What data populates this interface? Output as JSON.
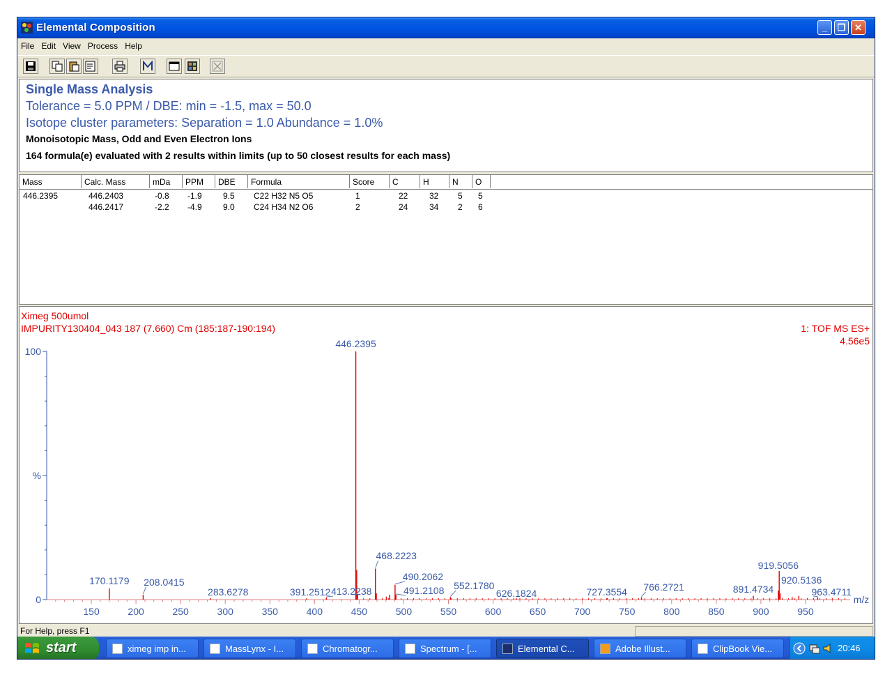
{
  "window": {
    "title": "Elemental Composition"
  },
  "menu": [
    "File",
    "Edit",
    "View",
    "Process",
    "Help"
  ],
  "header": {
    "title": "Single Mass Analysis",
    "tolerance": "Tolerance = 5.0 PPM   /   DBE: min = -1.5, max = 50.0",
    "isotope": "Isotope cluster parameters: Separation = 1.0   Abundance = 1.0%",
    "ion_type": "Monoisotopic Mass, Odd and Even Electron Ions",
    "summary": "164 formula(e) evaluated with 2 results within limits (up to 50 closest results for each mass)"
  },
  "table": {
    "columns": [
      "Mass",
      "Calc. Mass",
      "mDa",
      "PPM",
      "DBE",
      "Formula",
      "Score",
      "C",
      "H",
      "N",
      "O"
    ],
    "rows": [
      {
        "mass": "446.2395",
        "calc": "446.2403",
        "mda": "-0.8",
        "ppm": "-1.9",
        "dbe": "9.5",
        "formula": "C22 H32 N5 O5",
        "score": "1",
        "c": "22",
        "h": "32",
        "n": "5",
        "o": "5"
      },
      {
        "mass": "",
        "calc": "446.2417",
        "mda": "-2.2",
        "ppm": "-4.9",
        "dbe": "9.0",
        "formula": "C24 H34 N2 O6",
        "score": "2",
        "c": "24",
        "h": "34",
        "n": "2",
        "o": "6"
      }
    ]
  },
  "spectrum": {
    "sample": "Ximeg 500umol",
    "scan": "IMPURITY130404_043 187 (7.660) Cm (185:187-190:194)",
    "mode": "1: TOF MS ES+",
    "intensity": "4.56e5"
  },
  "chart_data": {
    "type": "bar",
    "xlabel": "m/z",
    "ylabel": "%",
    "xlim": [
      100,
      1000
    ],
    "ylim": [
      0,
      100
    ],
    "xticks": [
      150,
      200,
      250,
      300,
      350,
      400,
      450,
      500,
      550,
      600,
      650,
      700,
      750,
      800,
      850,
      900,
      950
    ],
    "yticks": [
      {
        "value": 100,
        "label": "100"
      },
      {
        "value": 50,
        "label": "%"
      },
      {
        "value": 0,
        "label": "0"
      }
    ],
    "peaks": [
      {
        "mz": 170.1179,
        "intensity": 4.5,
        "label": "170.1179"
      },
      {
        "mz": 208.0415,
        "intensity": 2.0,
        "label": "208.0415"
      },
      {
        "mz": 283.6278,
        "intensity": 0.5,
        "label": "283.6278"
      },
      {
        "mz": 391.2512,
        "intensity": 0.5,
        "label": "391.2512"
      },
      {
        "mz": 413.2238,
        "intensity": 0.8,
        "label": "413.2238"
      },
      {
        "mz": 446.2395,
        "intensity": 100,
        "label": "446.2395"
      },
      {
        "mz": 447.24,
        "intensity": 12,
        "label": ""
      },
      {
        "mz": 448.24,
        "intensity": 2.2,
        "label": ""
      },
      {
        "mz": 468.2223,
        "intensity": 12.5,
        "label": "468.2223"
      },
      {
        "mz": 469.23,
        "intensity": 2.5,
        "label": ""
      },
      {
        "mz": 480.5,
        "intensity": 1.2,
        "label": ""
      },
      {
        "mz": 484.2,
        "intensity": 2.0,
        "label": ""
      },
      {
        "mz": 490.2062,
        "intensity": 6.0,
        "label": "490.2062"
      },
      {
        "mz": 491.2108,
        "intensity": 2.0,
        "label": "491.2108"
      },
      {
        "mz": 552.178,
        "intensity": 1.0,
        "label": "552.1780"
      },
      {
        "mz": 626.1824,
        "intensity": 0.5,
        "label": "626.1824"
      },
      {
        "mz": 727.3554,
        "intensity": 0.5,
        "label": "727.3554"
      },
      {
        "mz": 766.2721,
        "intensity": 1.0,
        "label": "766.2721"
      },
      {
        "mz": 891.4734,
        "intensity": 1.5,
        "label": "891.4734"
      },
      {
        "mz": 919.5056,
        "intensity": 3.6,
        "label": "919.5056"
      },
      {
        "mz": 920.5136,
        "intensity": 11.5,
        "label": "920.5136"
      },
      {
        "mz": 921.52,
        "intensity": 2.5,
        "label": ""
      },
      {
        "mz": 935.0,
        "intensity": 1.0,
        "label": ""
      },
      {
        "mz": 942.5,
        "intensity": 1.5,
        "label": ""
      },
      {
        "mz": 963.4711,
        "intensity": 1.0,
        "label": "963.4711"
      }
    ]
  },
  "status": {
    "text": "For Help, press F1"
  },
  "taskbar": {
    "start": "start",
    "tasks": [
      {
        "label": "ximeg imp in...",
        "active": false
      },
      {
        "label": "MassLynx - I...",
        "active": false
      },
      {
        "label": "Chromatogr...",
        "active": false
      },
      {
        "label": "Spectrum - [...",
        "active": false
      },
      {
        "label": "Elemental C...",
        "active": true
      },
      {
        "label": "Adobe Illust...",
        "active": false
      },
      {
        "label": "ClipBook Vie...",
        "active": false
      }
    ],
    "clock": "20:46"
  },
  "colors": {
    "accent": "#3a5aa8",
    "spectrum": "#e00000",
    "axis": "#3a5aa8",
    "titlebar": "#0054e3"
  }
}
